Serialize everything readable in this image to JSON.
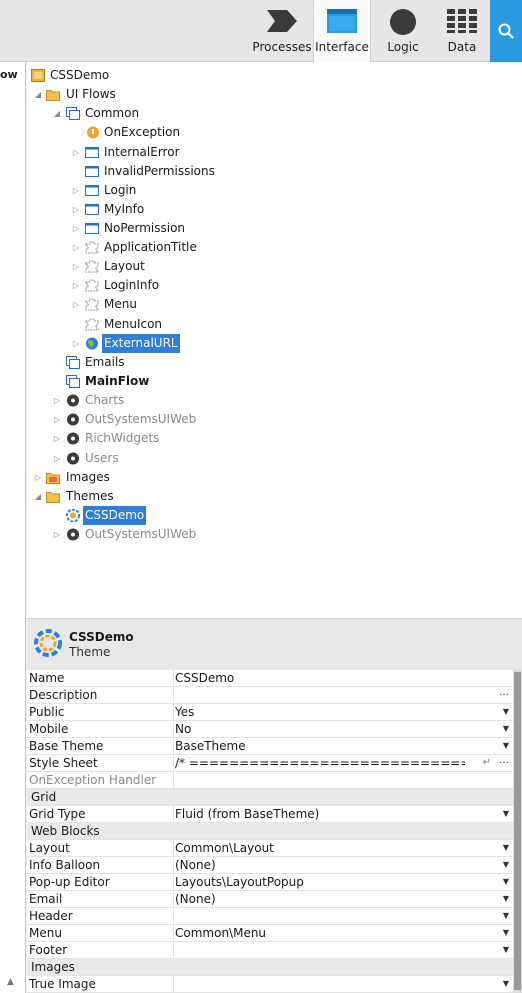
{
  "toolbar": {
    "tabs": [
      {
        "label": "Processes",
        "icon": "processes-icon"
      },
      {
        "label": "Interface",
        "icon": "interface-icon",
        "active": true
      },
      {
        "label": "Logic",
        "icon": "logic-icon"
      },
      {
        "label": "Data",
        "icon": "data-icon"
      }
    ],
    "search_icon": "search-icon",
    "accent": "#2b9be0"
  },
  "left_pane": {
    "text": "ow"
  },
  "tree": {
    "items": [
      {
        "label": "CSSDemo"
      },
      {
        "label": "UI Flows"
      },
      {
        "label": "Common"
      },
      {
        "label": "OnException"
      },
      {
        "label": "InternalError"
      },
      {
        "label": "InvalidPermissions"
      },
      {
        "label": "Login"
      },
      {
        "label": "MyInfo"
      },
      {
        "label": "NoPermission"
      },
      {
        "label": "ApplicationTitle"
      },
      {
        "label": "Layout"
      },
      {
        "label": "LoginInfo"
      },
      {
        "label": "Menu"
      },
      {
        "label": "MenuIcon"
      },
      {
        "label": "ExternalURL",
        "selected": true
      },
      {
        "label": "Emails"
      },
      {
        "label": "MainFlow"
      },
      {
        "label": "Charts"
      },
      {
        "label": "OutSystemsUIWeb"
      },
      {
        "label": "RichWidgets"
      },
      {
        "label": "Users"
      },
      {
        "label": "Images"
      },
      {
        "label": "Themes"
      },
      {
        "label": "CSSDemo",
        "selected": true
      },
      {
        "label": "OutSystemsUIWeb"
      }
    ],
    "selection_color": "#2f7ed8"
  },
  "properties": {
    "title": "CSSDemo",
    "subtitle": "Theme",
    "rows": [
      {
        "name": "Name",
        "value": "CSSDemo"
      },
      {
        "name": "Description",
        "value": ""
      },
      {
        "name": "Public",
        "value": "Yes"
      },
      {
        "name": "Mobile",
        "value": "No"
      },
      {
        "name": "Base Theme",
        "value": "BaseTheme"
      },
      {
        "name": "Style Sheet",
        "value": "/* =========================================="
      },
      {
        "name": "OnException Handler",
        "value": ""
      },
      {
        "name": "Grid",
        "value": ""
      },
      {
        "name": "Grid Type",
        "value": "Fluid (from BaseTheme)"
      },
      {
        "name": "Web Blocks",
        "value": ""
      },
      {
        "name": "Layout",
        "value": "Common\\Layout"
      },
      {
        "name": "Info Balloon",
        "value": "(None)"
      },
      {
        "name": "Pop-up Editor",
        "value": "Layouts\\LayoutPopup"
      },
      {
        "name": "Email",
        "value": "(None)"
      },
      {
        "name": "Header",
        "value": ""
      },
      {
        "name": "Menu",
        "value": "Common\\Menu"
      },
      {
        "name": "Footer",
        "value": ""
      },
      {
        "name": "Images",
        "value": ""
      },
      {
        "name": "True Image",
        "value": ""
      }
    ]
  }
}
